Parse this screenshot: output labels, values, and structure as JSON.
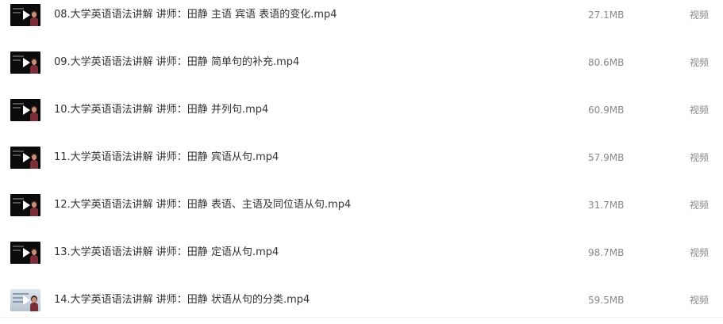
{
  "files": [
    {
      "name": "08.大学英语语法讲解 讲师：田静 主语 宾语 表语的变化.mp4",
      "size": "27.1MB",
      "type": "视频",
      "thumbnail": "dark"
    },
    {
      "name": "09.大学英语语法讲解 讲师：田静 简单句的补充.mp4",
      "size": "80.6MB",
      "type": "视频",
      "thumbnail": "dark"
    },
    {
      "name": "10.大学英语语法讲解 讲师：田静 并列句.mp4",
      "size": "60.9MB",
      "type": "视频",
      "thumbnail": "dark"
    },
    {
      "name": "11.大学英语语法讲解 讲师：田静 宾语从句.mp4",
      "size": "57.9MB",
      "type": "视频",
      "thumbnail": "dark"
    },
    {
      "name": "12.大学英语语法讲解 讲师：田静 表语、主语及同位语从句.mp4",
      "size": "31.7MB",
      "type": "视频",
      "thumbnail": "dark"
    },
    {
      "name": "13.大学英语语法讲解 讲师：田静 定语从句.mp4",
      "size": "98.7MB",
      "type": "视频",
      "thumbnail": "dark"
    },
    {
      "name": "14.大学英语语法讲解 讲师：田静 状语从句的分类.mp4",
      "size": "59.5MB",
      "type": "视频",
      "thumbnail": "light"
    }
  ],
  "icons": {
    "thumbnail_icon": "play-icon"
  },
  "colors": {
    "name_text": "#333333",
    "meta_text": "#888888",
    "thumb_dark": "#0b0b0b",
    "thumb_light": "#c9d0da"
  }
}
